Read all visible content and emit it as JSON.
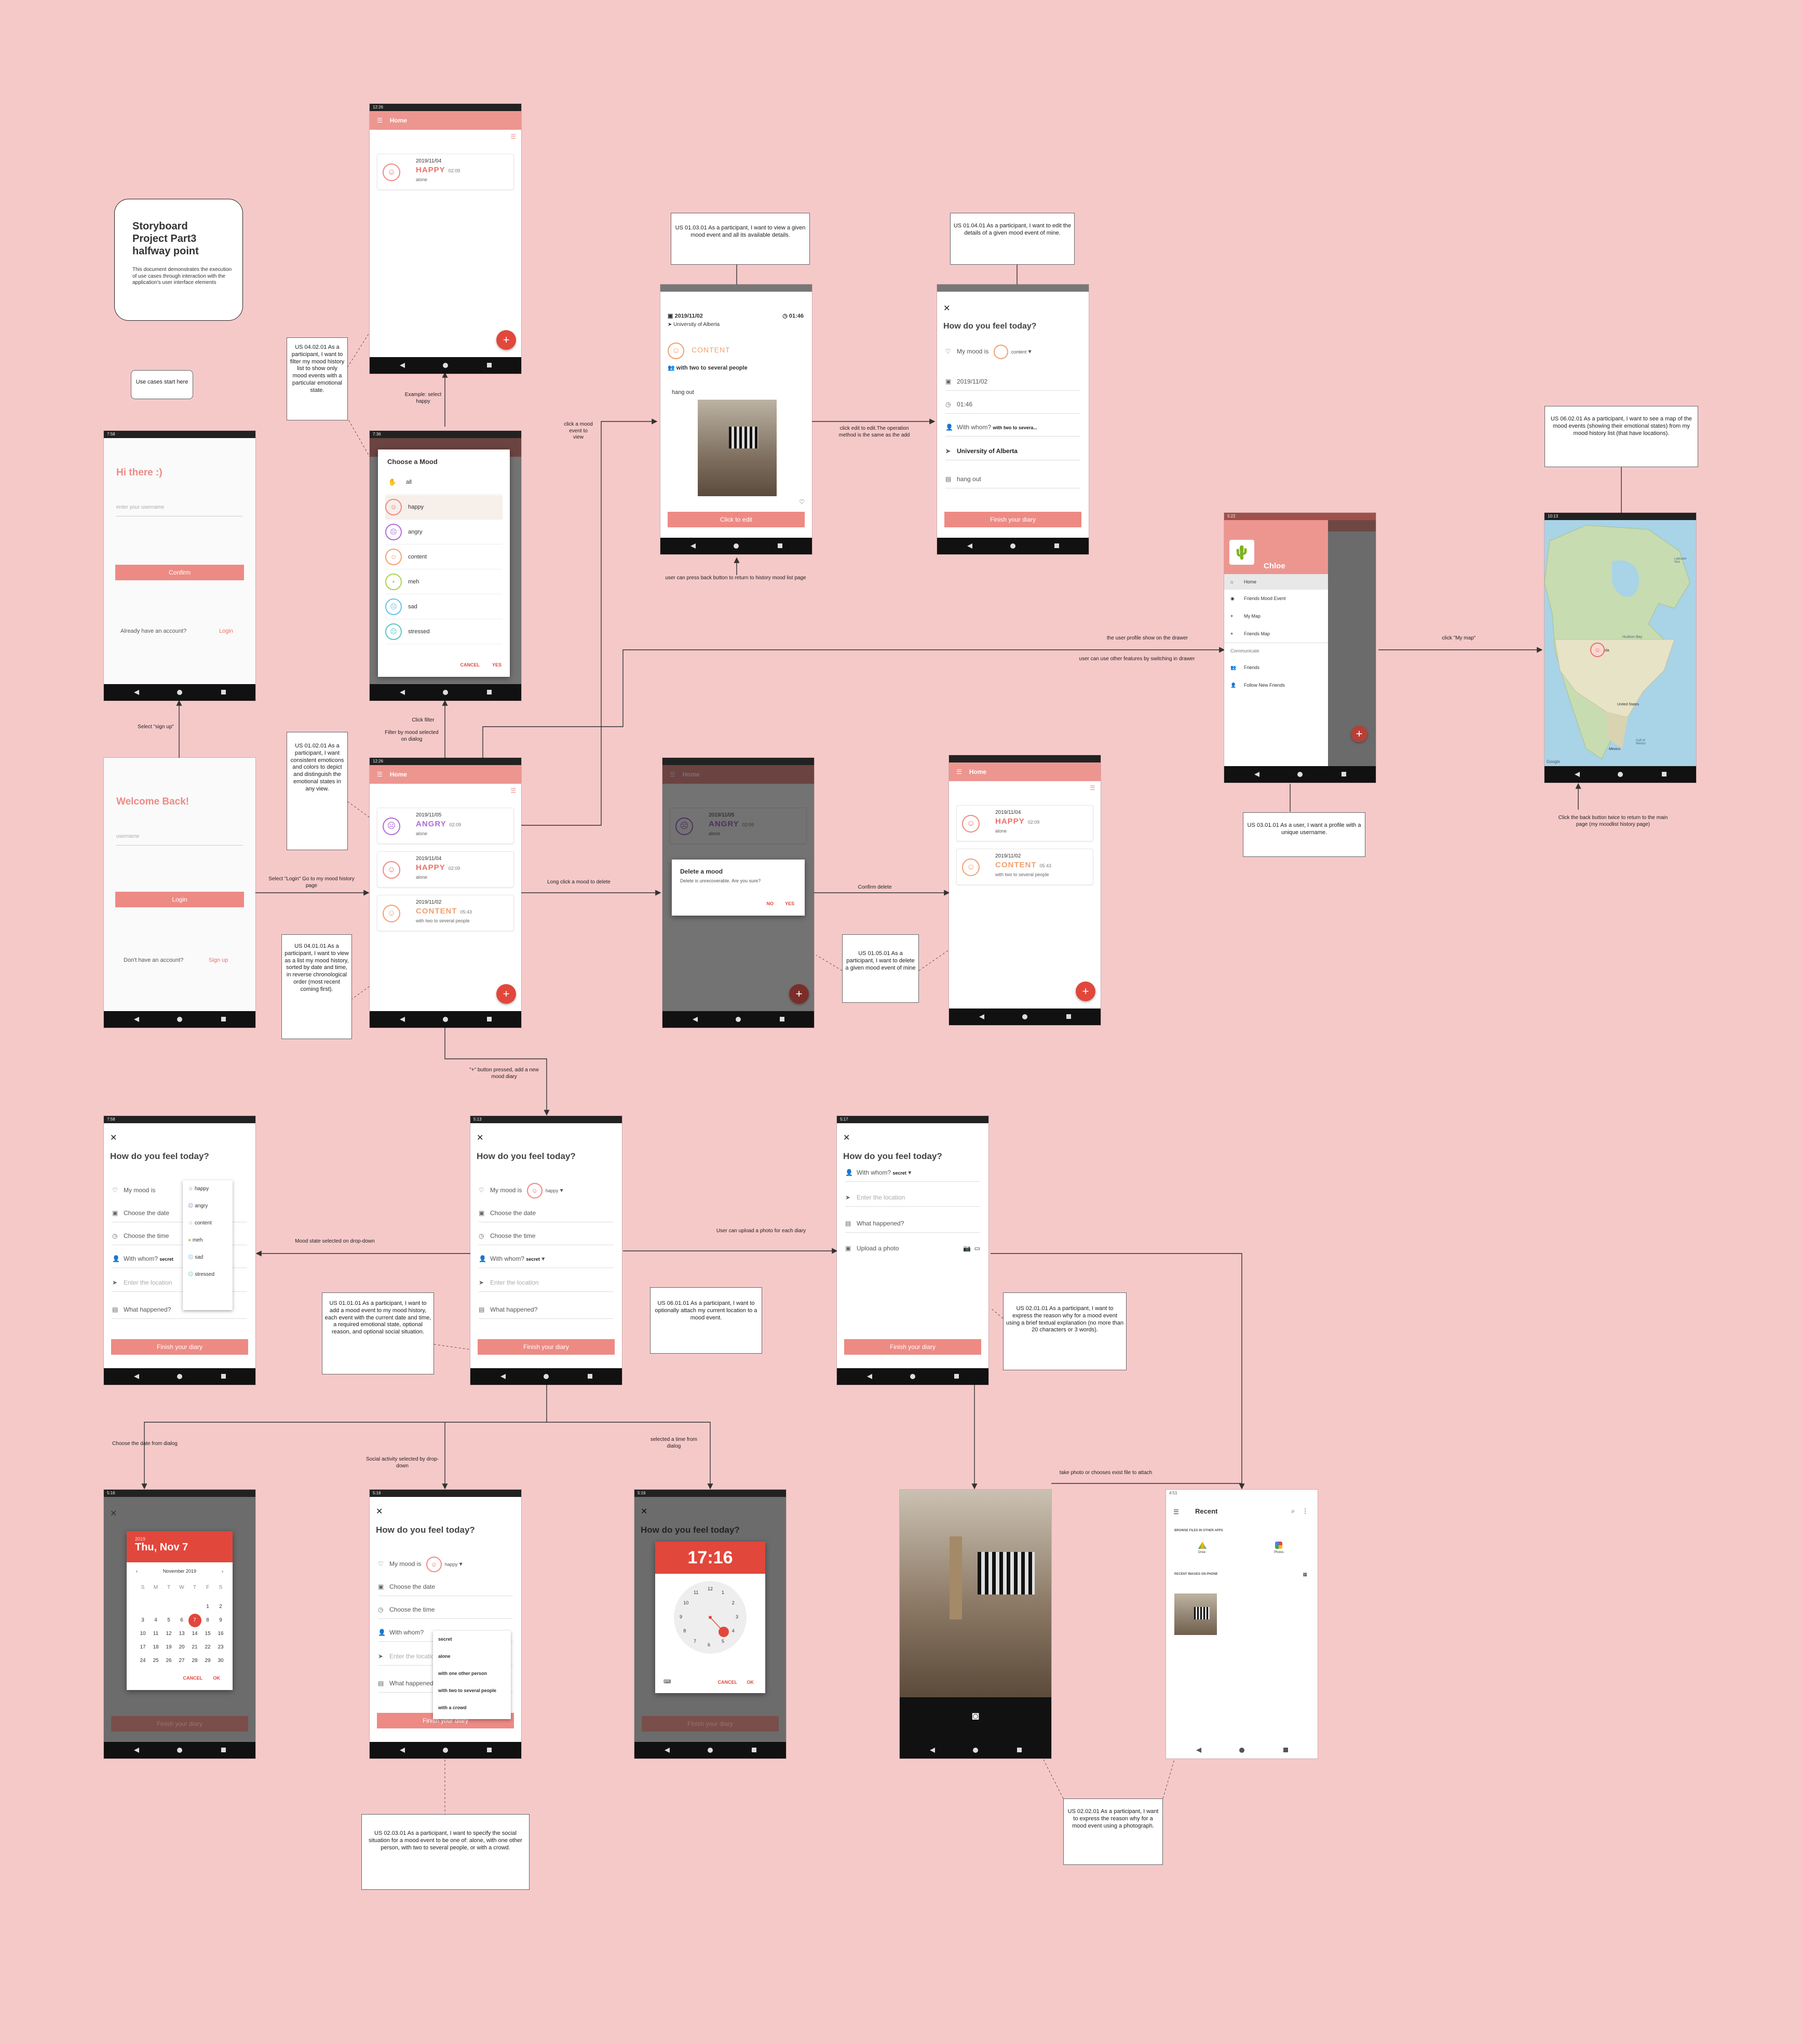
{
  "title_card": {
    "title": "Storyboard Project Part3 halfway point",
    "body": "This document demonstrates the execution of use cases through interaction with the application's user interface elements"
  },
  "use_cases_box": "Use cases start here",
  "notes": {
    "us010301": "US 01.03.01 As a participant, I want to view a given mood event and all its available details.",
    "us010401": "US 01.04.01 As a participant, I want to edit the details of a given mood event of mine.",
    "us040201": "US 04.02.01 As a participant, I want to filter my mood history list to show only mood events with a particular emotional state.",
    "us010201": "US 01.02.01 As a participant, I want consistent emoticons and colors to depict and distinguish the emotional states in any view.",
    "us040101": "US 04.01.01 As a participant, I want to view as a list my mood history, sorted by date and time, in reverse chronological order (most recent coming first).",
    "us010501": "US 01.05.01 As a participant, I want to delete a given mood event of mine",
    "us060201": "US 06.02.01 As a participant, I want to see a map of the mood events (showing their emotional states) from my mood history list (that have locations).",
    "us030101": "US 03.01.01 As a user, I want a profile with a unique username.",
    "us010101": "US 01.01.01 As a participant, I want to add a mood event to my mood history, each event with the current date and time, a required emotional state, optional reason, and optional social situation.",
    "us060101": "US 06.01.01 As a participant, I want to optionally attach my current location to a mood event.",
    "us020101": "US 02.01.01 As a participant, I want to express the reason why for a mood event using a brief textual explanation (no more than 20 characters or 3 words).",
    "us020301": "US 02.03.01 As a participant, I want to specify the social situation for a mood event to be one of: alone, with one other person, with two to several people, or with a crowd.",
    "us020201": "US 02.02.01 As a participant, I want to express the reason why for a mood event using a photograph."
  },
  "labels": {
    "example_happy": "Example: select happy",
    "click_filter": "Click filter",
    "filter_by_mood": "Filter by mood selected on dialog",
    "select_signup": "Select \"sign up\"",
    "select_login": "Select \"Login\" Go to my mood history page",
    "click_mood_view": "click a mood event to view",
    "back_button": "user can press back button to return to history mood list page",
    "click_edit": "click edit to edit.The operation method is the same as the add",
    "long_click": "Long click a mood to delete",
    "confirm_delete": "Confirm delete",
    "profile_drawer": "the user profile show on the drawer",
    "other_features": "user can use other features by switching in drawer",
    "click_my_map": "click \"My map\"",
    "back_twice": "Click the back button twice to return to the main page (my moodlist history page)",
    "plus_pressed": "\"+\" button pressed, add a new mood diary",
    "mood_dropdown": "Mood state selected on drop-down",
    "upload_photo": "User can upload a photo for each diary",
    "choose_date": "Choose the date from dialog",
    "social_dropdown": "Social activity selected by drop-down",
    "select_time": "selected a time from dialog",
    "take_photo": "take photo or chooses exist file to attach"
  },
  "login": {
    "greeting": "Hi there :)",
    "username_placeholder": "enter your username",
    "confirm": "Confirm",
    "already": "Already have an account?",
    "login_link": "Login"
  },
  "welcome": {
    "greeting": "Welcome Back!",
    "username_placeholder": "username",
    "login": "Login",
    "dont_have": "Don't have an account?",
    "signup_link": "Sign up"
  },
  "home": {
    "title": "Home",
    "entries": [
      {
        "date": "2019/11/05",
        "mood": "ANGRY",
        "time": "02:09",
        "social": "alone",
        "color": "#b06ad9"
      },
      {
        "date": "2019/11/04",
        "mood": "HAPPY",
        "time": "02:09",
        "social": "alone",
        "color": "#ed6f68"
      },
      {
        "date": "2019/11/02",
        "mood": "CONTENT",
        "time": "05:43",
        "social": "with two to several people",
        "color": "#f0a070"
      }
    ]
  },
  "status": {
    "t1": "12:26",
    "t2": "7:36",
    "t3": "7:36",
    "t4": "12:26",
    "t5": "5:22",
    "t6": "10:13",
    "t7": "7:58",
    "t8": "5:13",
    "t9": "5:17",
    "t10": "5:16",
    "t11": "5:16",
    "t12": "5:16",
    "t13": "4:51"
  },
  "choose_mood": {
    "title": "Choose a Mood",
    "options": [
      "all",
      "happy",
      "angry",
      "content",
      "meh",
      "sad",
      "stressed"
    ],
    "cancel": "CANCEL",
    "yes": "YES"
  },
  "view_mood": {
    "date": "2019/11/02",
    "time": "01:46",
    "location": "University of Alberta",
    "mood": "CONTENT",
    "social": "with two to several people",
    "reason": "hang out",
    "edit_btn": "Click to edit"
  },
  "edit_mood": {
    "title": "How do you feel today?",
    "my_mood": "My mood is",
    "mood_value": "content",
    "date": "2019/11/02",
    "time": "01:46",
    "with_whom": "With whom?",
    "with_whom_value": "with two to severa...",
    "location": "University of Alberta",
    "reason": "hang out",
    "finish": "Finish your diary"
  },
  "delete_dialog": {
    "title": "Delete a mood",
    "body": "Delete is unrecoverable. Are you sure?",
    "no": "NO",
    "yes": "YES"
  },
  "drawer": {
    "name": "Chloe",
    "items": [
      "Home",
      "Friends Mood Event",
      "My Map",
      "Friends Map"
    ],
    "section": "Communicate",
    "items2": [
      "Friends",
      "Follow New Friends"
    ]
  },
  "map": {
    "labels": [
      "Hudson Bay",
      "Canada",
      "United States",
      "Mexico",
      "Gulf of Mexico",
      "Labrador Sea",
      "Google"
    ]
  },
  "add_mood": {
    "title": "How do you feel today?",
    "my_mood": "My mood is",
    "mood_value": "happy",
    "choose_date": "Choose the date",
    "choose_time": "Choose the time",
    "with_whom": "With whom?",
    "with_whom_value": "secret",
    "enter_location": "Enter the location",
    "what_happened": "What happened?",
    "upload_photo": "Upload a photo",
    "finish": "Finish your diary",
    "mood_options": [
      "happy",
      "angry",
      "content",
      "meh",
      "sad",
      "stressed"
    ]
  },
  "date_picker": {
    "year": "2019",
    "date": "Thu, Nov 7",
    "month": "November 2019",
    "weekdays": [
      "S",
      "M",
      "T",
      "W",
      "T",
      "F",
      "S"
    ],
    "cancel": "CANCEL",
    "ok": "OK"
  },
  "social_menu": [
    "secret",
    "alone",
    "with one other person",
    "with two to several people",
    "with a crowd"
  ],
  "time_picker": {
    "time": "17:16",
    "cancel": "CANCEL",
    "ok": "OK"
  },
  "file_picker": {
    "title": "Recent",
    "browse": "BROWSE FILES IN OTHER APPS",
    "drive": "Drive",
    "photos": "Photos",
    "recent_images": "RECENT IMAGES ON PHONE"
  }
}
